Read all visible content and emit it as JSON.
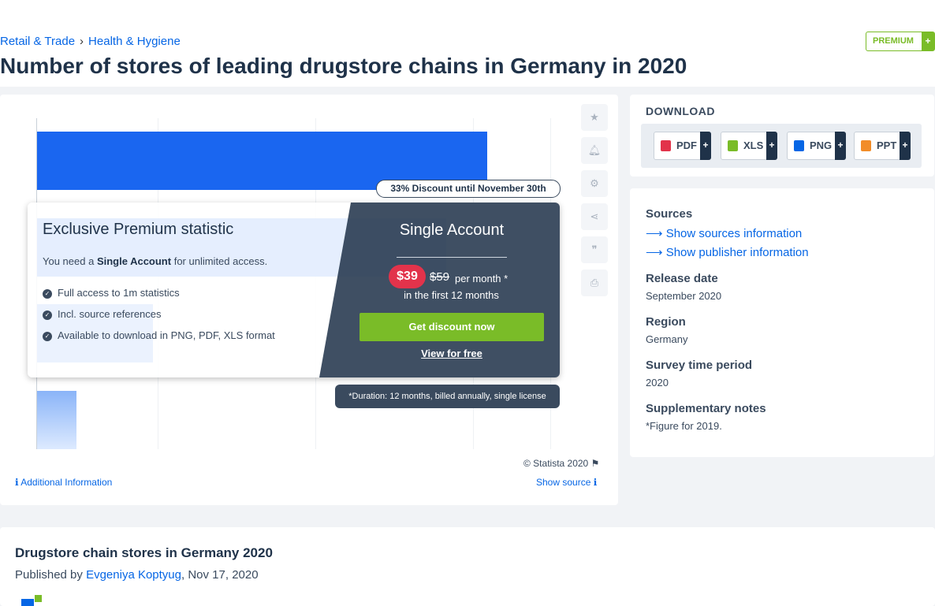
{
  "breadcrumb": {
    "items": [
      "Retail & Trade",
      "Health & Hygiene"
    ]
  },
  "premium_badge": {
    "label": "PREMIUM",
    "plus": "+"
  },
  "page_title": "Number of stores of leading drugstore chains in Germany in 2020",
  "promo": {
    "discount_pill": "33% Discount until November 30th",
    "heading": "Exclusive Premium statistic",
    "need_prefix": "You need a",
    "need_bold": "Single Account",
    "need_suffix": "for unlimited access.",
    "features": [
      "Full access to 1m statistics",
      "Incl. source references",
      "Available to download in PNG, PDF, XLS format"
    ],
    "account_title": "Single Account",
    "price": "$39",
    "old_price": "$59",
    "per_month": "per month *",
    "price_sub": "in the first 12 months",
    "cta": "Get discount now",
    "view_free": "View for free",
    "duration": "*Duration: 12 months, billed annually, single license"
  },
  "chart_footer": {
    "copyright": "© Statista 2020",
    "additional_info": "Additional Information",
    "show_source": "Show source"
  },
  "download": {
    "heading": "DOWNLOAD",
    "buttons": [
      {
        "label": "PDF",
        "color": "#e2334b"
      },
      {
        "label": "XLS",
        "color": "#7abc28"
      },
      {
        "label": "PNG",
        "color": "#0666e5"
      },
      {
        "label": "PPT",
        "color": "#f28c28"
      }
    ],
    "plus": "+"
  },
  "info": {
    "sources_label": "Sources",
    "show_sources": "Show sources information",
    "show_publisher": "Show publisher information",
    "release_label": "Release date",
    "release_value": "September 2020",
    "region_label": "Region",
    "region_value": "Germany",
    "survey_label": "Survey time period",
    "survey_value": "2020",
    "notes_label": "Supplementary notes",
    "notes_value": "*Figure for 2019."
  },
  "article": {
    "title": "Drugstore chain stores in Germany 2020",
    "published_by": "Published by",
    "author": "Evgeniya Koptyug",
    "date": ", Nov 17, 2020"
  },
  "colors": {
    "accent": "#0666e5",
    "premium_green": "#7abc28",
    "navy": "#1f3249",
    "price_red": "#e2334b"
  }
}
